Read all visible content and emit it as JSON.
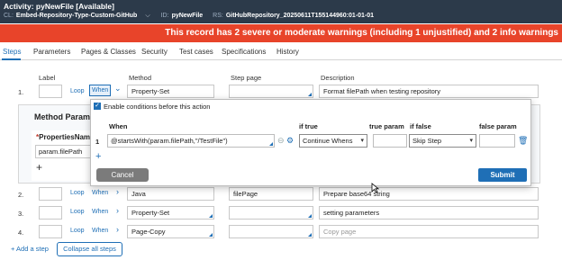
{
  "header": {
    "title": "Activity: pyNewFile [Available]",
    "cl_key": "CL:",
    "cl_value": "Embed-Repository-Type-Custom-GitHub",
    "id_key": "ID:",
    "id_value": "pyNewFile",
    "rs_key": "RS:",
    "rs_value": "GitHubRepository_20250611T155144960:01-01-01",
    "bg_color": "#2c3a4a"
  },
  "banner": {
    "text": "This record has 2 severe or moderate warnings (including 1 unjustified) and 2 info warnings",
    "color": "#e8442a"
  },
  "tabs": [
    "Steps",
    "Parameters",
    "Pages & Classes",
    "Security",
    "Test cases",
    "Specifications",
    "History"
  ],
  "active_tab": "Steps",
  "columns": {
    "label": "Label",
    "method": "Method",
    "step_page": "Step page",
    "description": "Description"
  },
  "rows": [
    {
      "num": "1.",
      "loop": "Loop",
      "when": "When",
      "method": "Property-Set",
      "step_page": "",
      "description": "Format filePath when testing repository"
    },
    {
      "num": "2.",
      "loop": "Loop",
      "when": "When",
      "method": "Java",
      "step_page": "filePage",
      "description": "Prepare base64 string"
    },
    {
      "num": "3.",
      "loop": "Loop",
      "when": "When",
      "method": "Property-Set",
      "step_page": "",
      "description": "setting parameters"
    },
    {
      "num": "4.",
      "loop": "Loop",
      "when": "When",
      "method": "Page-Copy",
      "step_page": "",
      "description": "",
      "description_placeholder": "Copy page"
    }
  ],
  "method_panel": {
    "title": "Method Parame",
    "properties_name": "PropertiesName",
    "param_value": "param.filePath"
  },
  "when_popover": {
    "checkbox_label": "Enable conditions before this action",
    "headers": {
      "when": "When",
      "if_true": "if true",
      "true_param": "true param",
      "if_false": "if false",
      "false_param": "false param"
    },
    "row_num": "1",
    "condition": "@startsWith(param.filePath,\"/TestFile\")",
    "if_true_value": "Continue Whens",
    "if_false_value": "Skip Step",
    "cancel_label": "Cancel",
    "submit_label": "Submit"
  },
  "footer": {
    "add_step": "+ Add a step",
    "collapse_all": "Collapse all steps"
  },
  "accent_color": "#1f6fb6"
}
